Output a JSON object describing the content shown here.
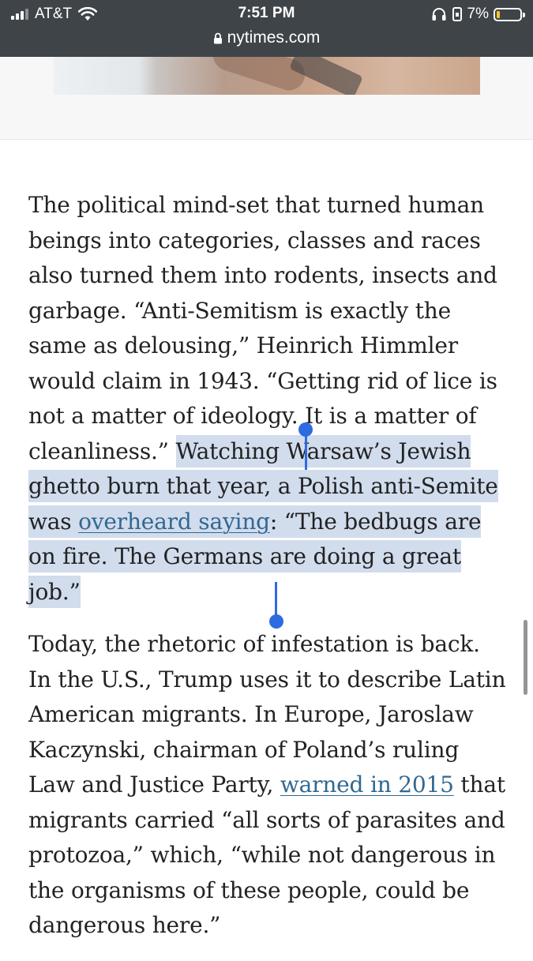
{
  "status_bar": {
    "carrier": "AT&T",
    "time": "7:51 PM",
    "battery_percent": "7%",
    "signal_bars": 3,
    "battery_level": 0.07,
    "battery_color": "#f4c430"
  },
  "browser": {
    "url": "nytimes.com",
    "lock_icon": "lock-icon"
  },
  "icons": {
    "signal": "signal-bars-icon",
    "wifi": "wifi-icon",
    "headphones": "headphones-icon",
    "rotation_lock": "rotation-lock-icon",
    "battery": "battery-icon"
  },
  "colors": {
    "status_bar_bg": "#3f4449",
    "link": "#326891",
    "selection": "#d1dced",
    "selection_handle": "#2f6be0"
  },
  "article": {
    "paragraph1": {
      "text_before_selection": "The political mind-set that turned human beings into categories, classes and races also turned them into rodents, insects and garbage. “Anti-Semitism is exactly the same as delousing,” Heinrich Himmler would claim in 1943. “Getting rid of lice is not a matter of ideology. It is a matter of cleanliness.” ",
      "selected_text_1": "Watching Warsaw’s Jewish ghetto burn that year, a Polish anti-Semite was ",
      "link_text": "overheard saying",
      "selected_text_2": ": “The bedbugs are on fire. The Germans are doing a great job.”"
    },
    "paragraph2": {
      "text_1": "Today, the rhetoric of infestation is back. In the U.S., Trump uses it to describe Latin American migrants. In Europe, Jaroslaw Kaczynski, chairman of Poland’s ruling Law and Justice Party, ",
      "link_text": "warned in 2015",
      "text_2": " that migrants carried “all sorts of parasites and protozoa,” which, “while not dangerous in the organisms of these people, could be dangerous here.”"
    }
  }
}
